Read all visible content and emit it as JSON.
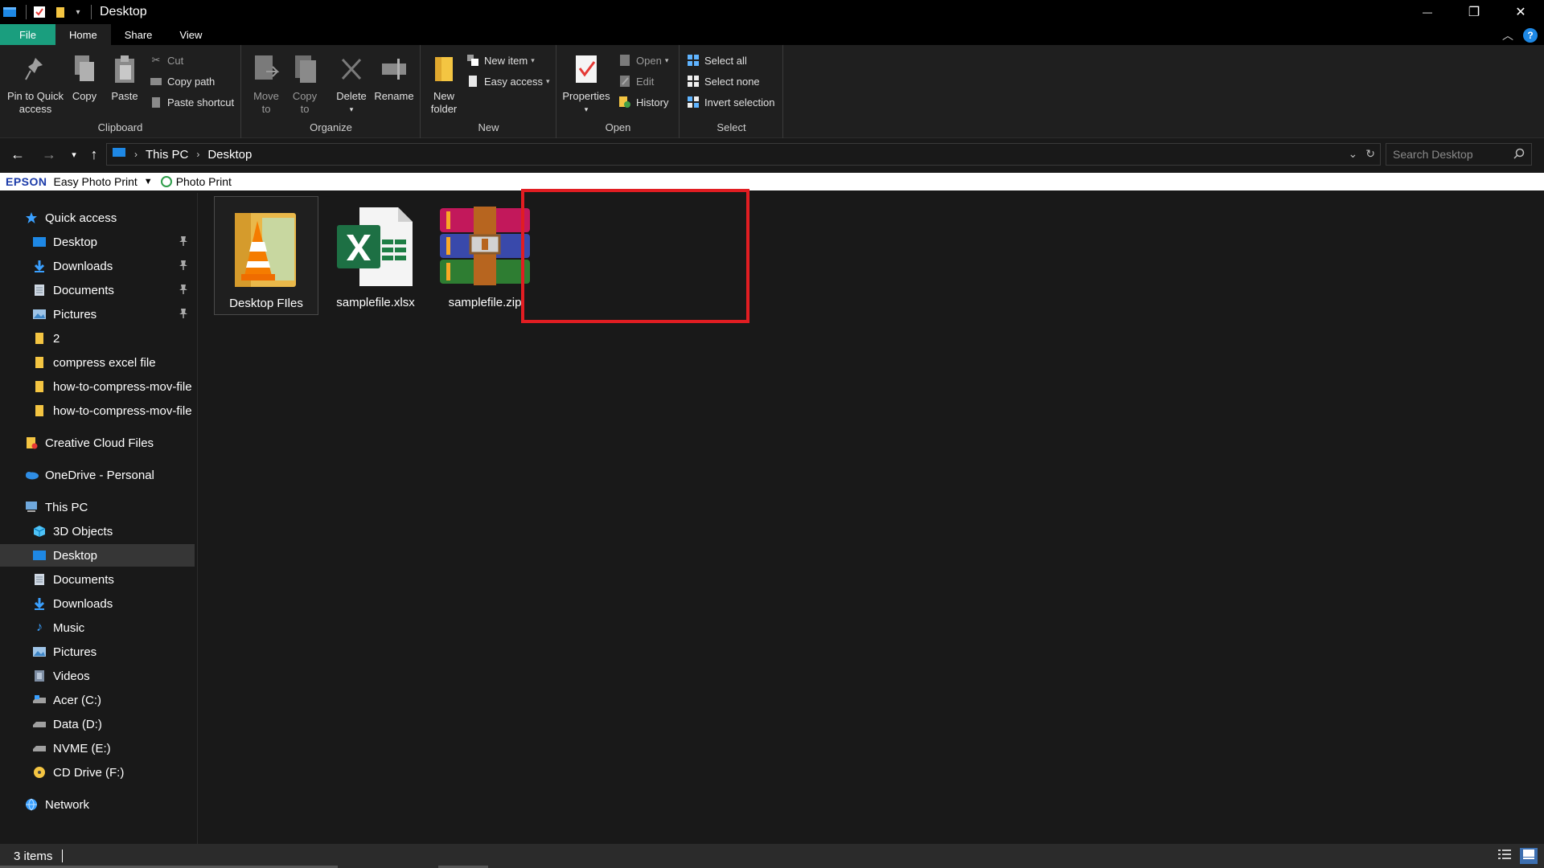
{
  "window": {
    "title": "Desktop",
    "controls": {
      "minimize": "—",
      "maximize": "❐",
      "close": "✕"
    }
  },
  "ribbon_tabs": [
    "File",
    "Home",
    "Share",
    "View"
  ],
  "ribbon": {
    "clipboard": {
      "label": "Clipboard",
      "pin_to_quick_access_line1": "Pin to Quick",
      "pin_to_quick_access_line2": "access",
      "copy": "Copy",
      "paste": "Paste",
      "cut": "Cut",
      "copy_path": "Copy path",
      "paste_shortcut": "Paste shortcut"
    },
    "organize": {
      "label": "Organize",
      "move_to_line1": "Move",
      "move_to_line2": "to",
      "copy_to_line1": "Copy",
      "copy_to_line2": "to",
      "delete": "Delete",
      "rename": "Rename"
    },
    "new": {
      "label": "New",
      "new_folder_line1": "New",
      "new_folder_line2": "folder",
      "new_item": "New item",
      "easy_access": "Easy access"
    },
    "open": {
      "label": "Open",
      "properties": "Properties",
      "open": "Open",
      "edit": "Edit",
      "history": "History"
    },
    "select": {
      "label": "Select",
      "select_all": "Select all",
      "select_none": "Select none",
      "invert_selection": "Invert selection"
    }
  },
  "address": {
    "crumbs": [
      "This PC",
      "Desktop"
    ],
    "search_placeholder": "Search Desktop"
  },
  "epson_bar": {
    "brand": "EPSON",
    "app": "Easy Photo Print",
    "photo_print": "Photo Print"
  },
  "sidebar": {
    "quick_access": "Quick access",
    "quick_items": [
      {
        "label": "Desktop",
        "pinned": true
      },
      {
        "label": "Downloads",
        "pinned": true
      },
      {
        "label": "Documents",
        "pinned": true
      },
      {
        "label": "Pictures",
        "pinned": true
      },
      {
        "label": "2"
      },
      {
        "label": "compress excel file"
      },
      {
        "label": "how-to-compress-mov-file"
      },
      {
        "label": "how-to-compress-mov-file"
      }
    ],
    "creative_cloud": "Creative Cloud Files",
    "onedrive": "OneDrive - Personal",
    "this_pc": "This PC",
    "pc_items": [
      "3D Objects",
      "Desktop",
      "Documents",
      "Downloads",
      "Music",
      "Pictures",
      "Videos",
      "Acer (C:)",
      "Data (D:)",
      "NVME (E:)",
      "CD Drive (F:)"
    ],
    "network": "Network"
  },
  "files": [
    {
      "name": "Desktop FIles",
      "type": "folder"
    },
    {
      "name": "samplefile.xlsx",
      "type": "excel"
    },
    {
      "name": "samplefile.zip",
      "type": "winrar"
    }
  ],
  "status": {
    "items_count": "3 items"
  },
  "colors": {
    "file_tab": "#1a9e7e",
    "highlight": "#e11d22",
    "accent_blue": "#1e88e5"
  }
}
